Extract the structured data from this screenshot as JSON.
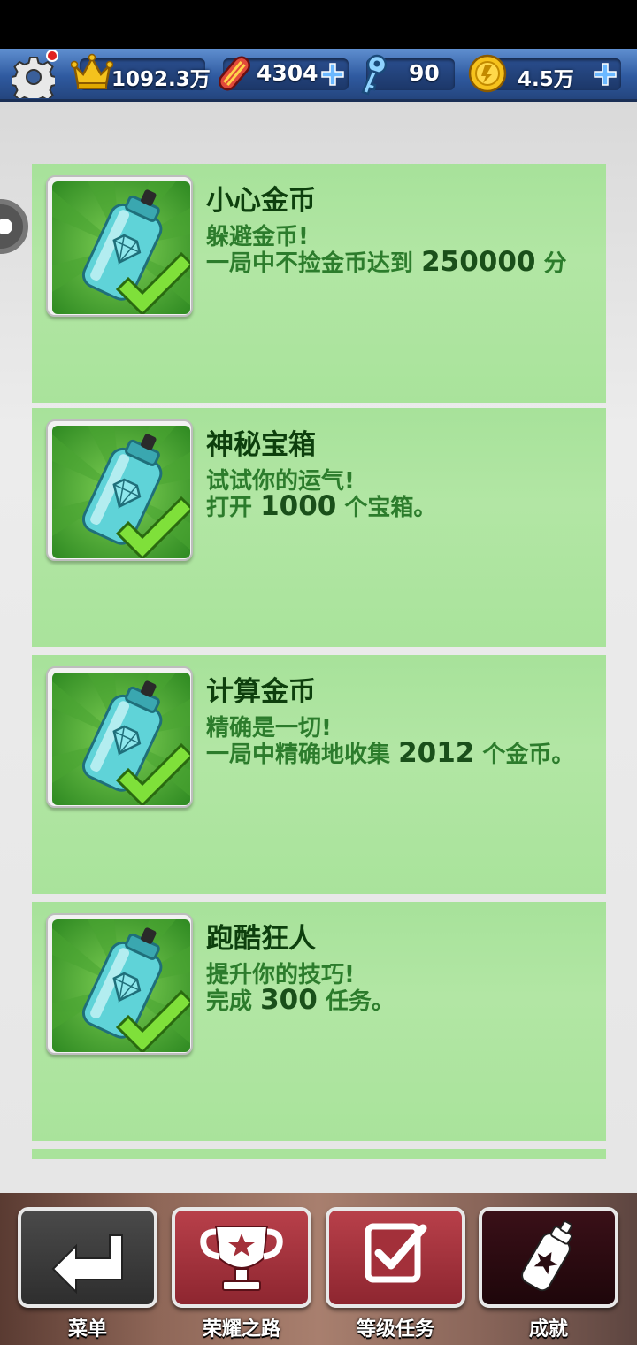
{
  "topbar": {
    "score": "1092.3万",
    "boards": "4304",
    "keys": "90",
    "coins": "4.5万"
  },
  "icons": {
    "settings": "gear-icon",
    "score": "crown-icon",
    "boards": "hoverboard-icon",
    "keys": "key-icon",
    "coins": "coin-icon",
    "achievement": "spray-can-icon",
    "completed": "checkmark-icon"
  },
  "achievements": [
    {
      "title": "小心金币",
      "subtitle": "躲避金币!",
      "desc_pre": " 一局中不捡金币达到 ",
      "desc_num": "250000",
      "desc_post": " 分"
    },
    {
      "title": "神秘宝箱",
      "subtitle": "试试你的运气!",
      "desc_pre": "打开 ",
      "desc_num": "1000",
      "desc_post": " 个宝箱。"
    },
    {
      "title": "计算金币",
      "subtitle": "精确是一切!",
      "desc_pre": "一局中精确地收集 ",
      "desc_num": "2012",
      "desc_post": " 个金币。"
    },
    {
      "title": "跑酷狂人",
      "subtitle": "提升你的技巧!",
      "desc_pre": "完成 ",
      "desc_num": "300",
      "desc_post": " 任务。"
    }
  ],
  "nav": {
    "menu": "菜单",
    "glory_road": "荣耀之路",
    "level_tasks": "等级任务",
    "achievements": "成就"
  },
  "colors": {
    "card_bg": "#a9e39b",
    "title": "#0d3f0d",
    "desc": "#2c7c2c",
    "nav_dark": "#3a3a3a",
    "nav_red": "#a3303a",
    "nav_active": "#2a0d12"
  }
}
